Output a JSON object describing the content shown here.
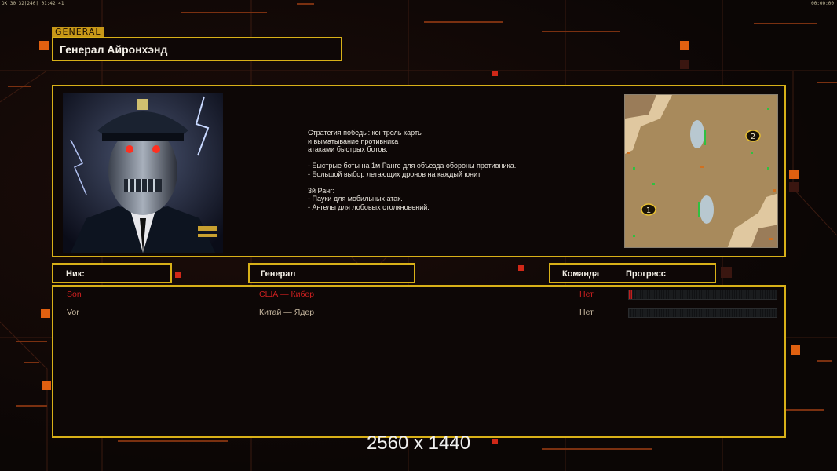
{
  "hud": {
    "top_left": "DX 30 32|240| 01:42:41",
    "top_right": "00:00:00"
  },
  "header": {
    "tag": "GENERAL",
    "title": "Генерал Айронхэнд"
  },
  "general": {
    "description": "Стратегия победы: контроль карты\nи выматывание противника\nатаками быстрых ботов.\n\n- Быстрые боты на 1м Ранге для объезда обороны противника.\n- Большой выбор летающих дронов на каждый юнит.\n\n3й Ранг:\n- Пауки для мобильных атак.\n- Ангелы для лобовых столкновений.",
    "portrait_icon": "cyborg-general-portrait",
    "map_icon": "minimap"
  },
  "map": {
    "spawn_1": "1",
    "spawn_2": "2"
  },
  "columns": {
    "nick": "Ник:",
    "general": "Генерал",
    "team": "Команда",
    "progress": "Прогресс"
  },
  "players": [
    {
      "nick": "Son",
      "general": "США — Кибер",
      "team": "Нет",
      "progress": 0.02,
      "color": "#d02020"
    },
    {
      "nick": "Vor",
      "general": "Китай — Ядер",
      "team": "Нет",
      "progress": 0,
      "color": "#c8b8a0"
    }
  ],
  "resolution_label": "2560 x 1440",
  "colors": {
    "frame": "#d8b018",
    "accent_orange": "#e06010",
    "accent_red": "#d02818"
  }
}
